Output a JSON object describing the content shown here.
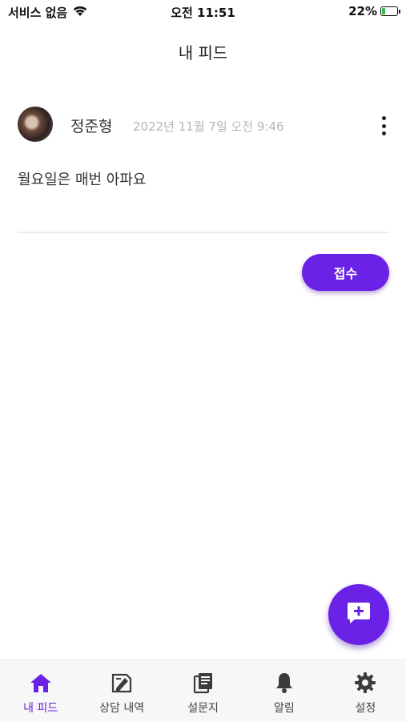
{
  "status_bar": {
    "carrier": "서비스 없음",
    "time": "오전 11:51",
    "battery": "22%",
    "battery_level": 0.22
  },
  "header": {
    "title": "내 피드"
  },
  "post": {
    "author": "정준형",
    "date": "2022년 11월 7일 오전 9:46",
    "content": "월요일은 매번 아파요",
    "more_icon": "more-vertical-icon"
  },
  "actions": {
    "receive_label": "접수"
  },
  "fab": {
    "icon": "add-comment-icon"
  },
  "tabs": [
    {
      "label": "내 피드",
      "icon": "home-icon",
      "active": true
    },
    {
      "label": "상담 내역",
      "icon": "consult-history-icon",
      "active": false
    },
    {
      "label": "설문지",
      "icon": "survey-icon",
      "active": false
    },
    {
      "label": "알림",
      "icon": "bell-icon",
      "active": false
    },
    {
      "label": "설정",
      "icon": "gear-icon",
      "active": false
    }
  ],
  "colors": {
    "accent": "#6a22e6",
    "inactive_icon": "#3c3c3c",
    "date_text": "#b5b5b5"
  }
}
